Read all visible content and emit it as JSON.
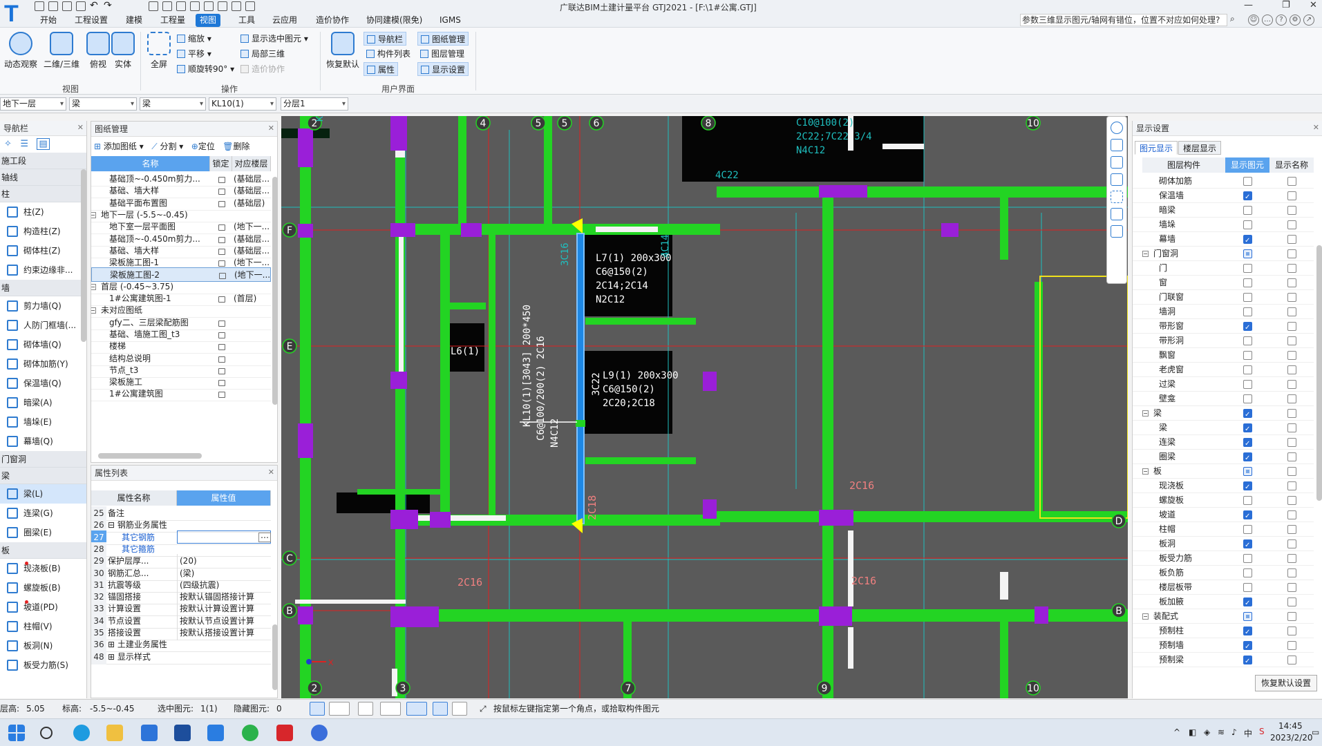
{
  "app": {
    "title": "广联达BIM土建计量平台 GTJ2021 - [F:\\1#公寓.GTJ]",
    "logo": "T"
  },
  "menu": [
    "开始",
    "工程设置",
    "建模",
    "工程量",
    "视图",
    "工具",
    "云应用",
    "造价协作",
    "协同建模(限免)",
    "IGMS"
  ],
  "active_menu": "视图",
  "faq": "参数三维显示图元/轴网有错位，位置不对应如何处理?",
  "ribbon": {
    "view_group": {
      "label": "视图",
      "buttons": [
        "动态观察",
        "二维/三维",
        "俯视",
        "实体"
      ]
    },
    "ops_group": {
      "label": "操作",
      "fullscreen": "全屏",
      "zoom": "缩放",
      "pan": "平移",
      "rotate": "顺旋转90°",
      "show_sel": "显示选中图元",
      "local3d": "局部三维",
      "cost": "造价协作"
    },
    "ui_group": {
      "label": "用户界面",
      "restore": "恢复默认",
      "nav": "导航栏",
      "comp_list": "构件列表",
      "props": "属性",
      "dwg_mgr": "图纸管理",
      "layer_mgr": "图层管理",
      "disp_set": "显示设置"
    }
  },
  "selectors": [
    "地下一层",
    "梁",
    "梁",
    "KL10(1)",
    "分层1"
  ],
  "nav": {
    "title": "导航栏",
    "groups": [
      {
        "cat": "施工段",
        "items": []
      },
      {
        "cat": "轴线",
        "items": []
      },
      {
        "cat": "柱",
        "items": [
          "柱(Z)",
          "构造柱(Z)",
          "砌体柱(Z)",
          "约束边缘非..."
        ]
      },
      {
        "cat": "墙",
        "items": [
          "剪力墙(Q)",
          "人防门框墙(...",
          "砌体墙(Q)",
          "砌体加筋(Y)",
          "保温墙(Q)",
          "暗梁(A)",
          "墙垛(E)",
          "幕墙(Q)"
        ]
      },
      {
        "cat": "门窗洞",
        "items": []
      },
      {
        "cat": "梁",
        "items": [
          "梁(L)",
          "连梁(G)",
          "圈梁(E)"
        ]
      },
      {
        "cat": "板",
        "items": [
          "现浇板(B)",
          "螺旋板(B)",
          "坡道(PD)",
          "柱帽(V)",
          "板洞(N)",
          "板受力筋(S)"
        ]
      }
    ]
  },
  "dwg": {
    "title": "图纸管理",
    "add": "添加图纸",
    "split": "分割",
    "locate": "定位",
    "delete": "删除",
    "cols": [
      "名称",
      "锁定",
      "对应楼层"
    ],
    "rows": [
      {
        "indent": 1,
        "name": "基础顶~-0.450m剪力...",
        "floor": "(基础层..."
      },
      {
        "indent": 1,
        "name": "基础、墙大样",
        "floor": "(基础层..."
      },
      {
        "indent": 1,
        "name": "基础平面布置图",
        "floor": "(基础层)"
      },
      {
        "indent": 0,
        "name": "地下一层 (-5.5~-0.45)",
        "floor": "",
        "group": true
      },
      {
        "indent": 1,
        "name": "地下室一层平面图",
        "floor": "(地下一..."
      },
      {
        "indent": 1,
        "name": "基础顶~-0.450m剪力...",
        "floor": "(基础层..."
      },
      {
        "indent": 1,
        "name": "基础、墙大样",
        "floor": "(基础层..."
      },
      {
        "indent": 1,
        "name": "梁板施工图-1",
        "floor": "(地下一..."
      },
      {
        "indent": 1,
        "name": "梁板施工图-2",
        "floor": "(地下一...",
        "selected": true
      },
      {
        "indent": 0,
        "name": "首层 (-0.45~3.75)",
        "floor": "",
        "group": true
      },
      {
        "indent": 1,
        "name": "1#公寓建筑图-1",
        "floor": "(首层)"
      },
      {
        "indent": 0,
        "name": "未对应图纸",
        "floor": "",
        "group": true
      },
      {
        "indent": 1,
        "name": "gfy二、三层梁配筋图",
        "floor": ""
      },
      {
        "indent": 1,
        "name": "基础、墙施工图_t3",
        "floor": ""
      },
      {
        "indent": 1,
        "name": "楼梯",
        "floor": ""
      },
      {
        "indent": 1,
        "name": "结构总说明",
        "floor": ""
      },
      {
        "indent": 1,
        "name": "节点_t3",
        "floor": ""
      },
      {
        "indent": 1,
        "name": "梁板施工",
        "floor": ""
      },
      {
        "indent": 1,
        "name": "1#公寓建筑图",
        "floor": ""
      }
    ]
  },
  "props": {
    "title": "属性列表",
    "cols": [
      "属性名称",
      "属性值"
    ],
    "rows": [
      {
        "n": "25",
        "k": "备注",
        "v": ""
      },
      {
        "n": "26",
        "k": "⊟ 钢筋业务属性",
        "v": ""
      },
      {
        "n": "27",
        "k": "其它钢筋",
        "v": "",
        "blue": true,
        "edit": true
      },
      {
        "n": "28",
        "k": "其它箍筋",
        "v": "",
        "blue": true
      },
      {
        "n": "29",
        "k": "保护层厚...",
        "v": "(20)"
      },
      {
        "n": "30",
        "k": "钢筋汇总...",
        "v": "(梁)"
      },
      {
        "n": "31",
        "k": "抗震等级",
        "v": "(四级抗震)"
      },
      {
        "n": "32",
        "k": "锚固搭接",
        "v": "按默认锚固搭接计算"
      },
      {
        "n": "33",
        "k": "计算设置",
        "v": "按默认计算设置计算"
      },
      {
        "n": "34",
        "k": "节点设置",
        "v": "按默认节点设置计算"
      },
      {
        "n": "35",
        "k": "搭接设置",
        "v": "按默认搭接设置计算"
      },
      {
        "n": "36",
        "k": "⊞ 土建业务属性",
        "v": ""
      },
      {
        "n": "48",
        "k": "⊞ 显示样式",
        "v": ""
      }
    ]
  },
  "canvas": {
    "axis_top": [
      "2",
      "4",
      "5",
      "5",
      "6",
      "8",
      "10"
    ],
    "axis_bottom": [
      "2",
      "3",
      "7",
      "9",
      "10"
    ],
    "axis_left": [
      "F",
      "E",
      "C",
      "B"
    ],
    "axis_right": [
      "D",
      "B"
    ],
    "labels": {
      "l7": [
        "L7(1) 200x300",
        "C6@150(2)",
        "2C14;2C14",
        "N2C12"
      ],
      "l9": [
        "L9(1) 200x300",
        "C6@150(2)",
        "2C20;2C18"
      ],
      "l6": "L6(1)",
      "kl10": "KL10(1)[3043] 200*450",
      "kl10b": "C6@100/200(2) 2C16",
      "kl10c": "N4C12",
      "c3c22": "3C22",
      "c3c16": "3C16",
      "c2c18": "2C18",
      "c4c22": "4C22",
      "c4c14": "4C14",
      "c2c16a": "2C16",
      "c2c16b": "2C16",
      "c2c16c": "2C16",
      "tr1": "C10@100(2)",
      "tr2": "2C22;7C22 3/4",
      "tr3": "N4C12"
    }
  },
  "disp": {
    "title": "显示设置",
    "tabs": [
      "图元显示",
      "楼层显示"
    ],
    "cols": [
      "图层构件",
      "显示图元",
      "显示名称"
    ],
    "items": [
      {
        "name": "砌体加筋",
        "s": 0,
        "n": 0,
        "lvl": 1
      },
      {
        "name": "保温墙",
        "s": 1,
        "n": 0,
        "lvl": 1
      },
      {
        "name": "暗梁",
        "s": 0,
        "n": 0,
        "lvl": 1
      },
      {
        "name": "墙垛",
        "s": 0,
        "n": 0,
        "lvl": 1
      },
      {
        "name": "幕墙",
        "s": 1,
        "n": 0,
        "lvl": 1
      },
      {
        "name": "门窗洞",
        "s": 2,
        "n": 0,
        "lvl": 0
      },
      {
        "name": "门",
        "s": 0,
        "n": 0,
        "lvl": 1
      },
      {
        "name": "窗",
        "s": 0,
        "n": 0,
        "lvl": 1
      },
      {
        "name": "门联窗",
        "s": 0,
        "n": 0,
        "lvl": 1
      },
      {
        "name": "墙洞",
        "s": 0,
        "n": 0,
        "lvl": 1
      },
      {
        "name": "带形窗",
        "s": 1,
        "n": 0,
        "lvl": 1
      },
      {
        "name": "带形洞",
        "s": 0,
        "n": 0,
        "lvl": 1
      },
      {
        "name": "飘窗",
        "s": 0,
        "n": 0,
        "lvl": 1
      },
      {
        "name": "老虎窗",
        "s": 0,
        "n": 0,
        "lvl": 1
      },
      {
        "name": "过梁",
        "s": 0,
        "n": 0,
        "lvl": 1
      },
      {
        "name": "壁龛",
        "s": 0,
        "n": 0,
        "lvl": 1
      },
      {
        "name": "梁",
        "s": 1,
        "n": 0,
        "lvl": 0
      },
      {
        "name": "梁",
        "s": 1,
        "n": 0,
        "lvl": 1
      },
      {
        "name": "连梁",
        "s": 1,
        "n": 0,
        "lvl": 1
      },
      {
        "name": "圈梁",
        "s": 1,
        "n": 0,
        "lvl": 1
      },
      {
        "name": "板",
        "s": 2,
        "n": 0,
        "lvl": 0
      },
      {
        "name": "现浇板",
        "s": 1,
        "n": 0,
        "lvl": 1
      },
      {
        "name": "螺旋板",
        "s": 0,
        "n": 0,
        "lvl": 1
      },
      {
        "name": "坡道",
        "s": 1,
        "n": 0,
        "lvl": 1
      },
      {
        "name": "柱帽",
        "s": 0,
        "n": 0,
        "lvl": 1
      },
      {
        "name": "板洞",
        "s": 1,
        "n": 0,
        "lvl": 1
      },
      {
        "name": "板受力筋",
        "s": 0,
        "n": 0,
        "lvl": 1
      },
      {
        "name": "板负筋",
        "s": 0,
        "n": 0,
        "lvl": 1
      },
      {
        "name": "楼层板带",
        "s": 0,
        "n": 0,
        "lvl": 1
      },
      {
        "name": "板加腋",
        "s": 1,
        "n": 0,
        "lvl": 1
      },
      {
        "name": "装配式",
        "s": 2,
        "n": 0,
        "lvl": 0
      },
      {
        "name": "预制柱",
        "s": 1,
        "n": 0,
        "lvl": 1
      },
      {
        "name": "预制墙",
        "s": 1,
        "n": 0,
        "lvl": 1
      },
      {
        "name": "预制梁",
        "s": 1,
        "n": 0,
        "lvl": 1
      }
    ],
    "restore": "恢复默认设置"
  },
  "status": {
    "floor_h_label": "层高:",
    "floor_h": "5.05",
    "elev_label": "标高:",
    "elev": "-5.5~-0.45",
    "sel_label": "选中图元:",
    "sel": "1(1)",
    "hid_label": "隐藏图元:",
    "hid": "0",
    "hint": "按鼠标左键指定第一个角点，或拾取构件图元"
  },
  "taskbar": {
    "ime": "中",
    "time": "14:45",
    "date": "2023/2/20"
  },
  "colors": {
    "beam": "#23d423",
    "column": "#9a1fd8",
    "selected": "#1e88e5",
    "annot": "#1fbfbf",
    "axis": "#e02020",
    "accent": "#1e78d7"
  }
}
